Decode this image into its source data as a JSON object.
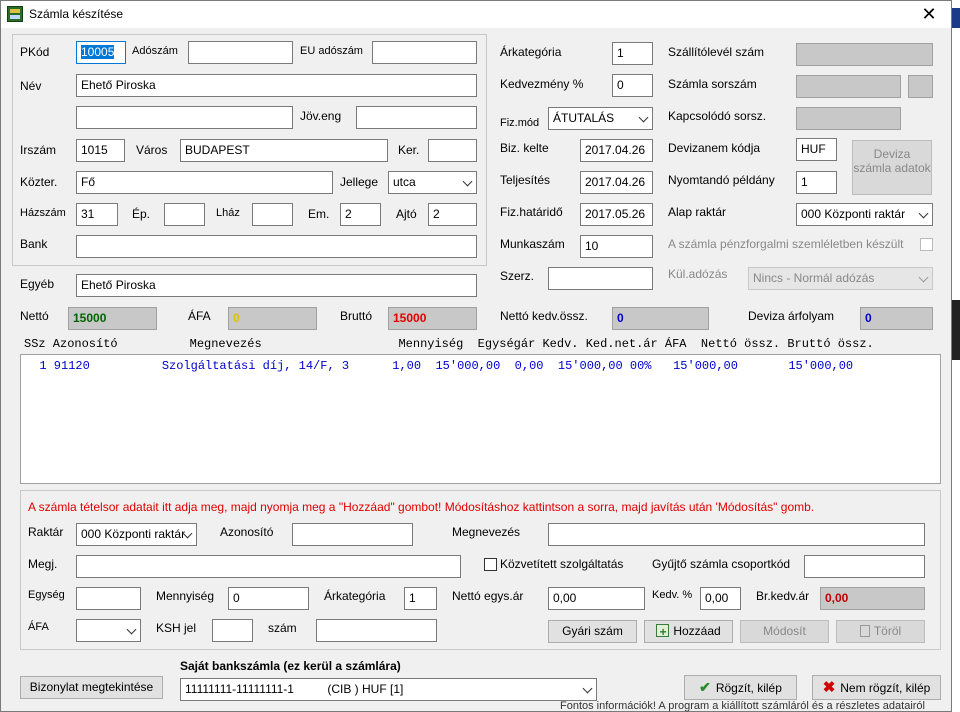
{
  "window": {
    "title": "Számla készítése",
    "close": "✕"
  },
  "customer": {
    "pkod_label": "PKód",
    "pkod_value": "10005",
    "adoszam_label": "Adószám",
    "adoszam_value": "",
    "eu_label": "EU adószám",
    "eu_value": "",
    "nev_label": "Név",
    "nev_value": "Ehető Piroska",
    "nev2_value": "",
    "joveng_label": "Jöv.eng",
    "joveng_value": "",
    "irszam_label": "Irszám",
    "irszam_value": "1015",
    "varos_label": "Város",
    "varos_value": "BUDAPEST",
    "ker_label": "Ker.",
    "ker_value": "",
    "kozter_label": "Közter.",
    "kozter_value": "Fő",
    "jellege_label": "Jellege",
    "jellege_value": "utca",
    "hazszam_label": "Házszám",
    "hazszam_value": "31",
    "ep_label": "Ép.",
    "ep_value": "",
    "lhaz_label": "Lház",
    "lhaz_value": "",
    "em_label": "Em.",
    "em_value": "2",
    "ajto_label": "Ajtó",
    "ajto_value": "2",
    "bank_label": "Bank",
    "bank_value": "",
    "egyeb_label": "Egyéb",
    "egyeb_value": "Ehető Piroska"
  },
  "totals": {
    "netto_label": "Nettó",
    "netto_value": "15000",
    "afa_label": "ÁFA",
    "afa_value": "0",
    "brutto_label": "Bruttó",
    "brutto_value": "15000",
    "netto_kedv_label": "Nettó kedv.össz.",
    "netto_kedv_value": "0",
    "deviza_arf_label": "Deviza árfolyam",
    "deviza_arf_value": "0"
  },
  "invoice": {
    "arkat_label": "Árkategória",
    "arkat_value": "1",
    "kedv_label": "Kedvezmény %",
    "kedv_value": "0",
    "fizmod_label": "Fiz.mód",
    "fizmod_value": "ÁTUTALÁS",
    "bizkelte_label": "Biz. kelte",
    "bizkelte_value": "2017.04.26",
    "telj_label": "Teljesítés",
    "telj_value": "2017.04.26",
    "hatarido_label": "Fiz.határidő",
    "hatarido_value": "2017.05.26",
    "munkaszam_label": "Munkaszám",
    "munkaszam_value": "10",
    "szerz_label": "Szerz.",
    "szerz_value": ""
  },
  "right": {
    "szallito_label": "Szállítólevél szám",
    "sorszam_label": "Számla sorszám",
    "kapcs_label": "Kapcsolódó sorsz.",
    "devizanem_label": "Devizanem kódja",
    "devizanem_value": "HUF",
    "nyomt_label": "Nyomtandó példány",
    "nyomt_value": "1",
    "deviza_btn": "Deviza számla adatok",
    "raktar_label": "Alap raktár",
    "raktar_value": "000 Központi raktár",
    "penzforg_label": "A számla pénzforgalmi szemléletben készült",
    "kuladozas_label": "Kül.adózás",
    "kuladozas_value": "Nincs - Normál adózás"
  },
  "grid": {
    "header": "SSz Azonosító          Megnevezés                   Mennyiség  Egységár Kedv. Ked.net.ár ÁFA  Nettó össz. Bruttó össz.",
    "rows": [
      "  1 91120          Szolgáltatási díj, 14/F, 3      1,00  15'000,00  0,00  15'000,00 00%   15'000,00       15'000,00"
    ]
  },
  "item": {
    "hint": "A számla tételsor adatait itt adja meg, majd nyomja meg a \"Hozzáad\" gombot! Módosításhoz kattintson a sorra, majd javítás után 'Módosítás\" gomb.",
    "raktar_label": "Raktár",
    "raktar_value": "000 Központi raktár",
    "azon_label": "Azonosító",
    "azon_value": "",
    "megnev_label": "Megnevezés",
    "megnev_value": "",
    "megj_label": "Megj.",
    "megj_value": "",
    "kozvetitett_label": "Közvetített szolgáltatás",
    "gyujto_label": "Gyűjtő számla csoportkód",
    "gyujto_value": "",
    "egyseg_label": "Egység",
    "egyseg_value": "",
    "menny_label": "Mennyiség",
    "menny_value": "0",
    "arkat_label": "Árkategória",
    "arkat_value": "1",
    "nettoegys_label": "Nettó egys.ár",
    "nettoegys_value": "0,00",
    "kedv_label": "Kedv. %",
    "kedv_value": "0,00",
    "brkedv_label": "Br.kedv.ár",
    "brkedv_value": "0,00",
    "afa_label": "ÁFA",
    "afa_value": "",
    "ksh_label": "KSH jel",
    "ksh_value": "",
    "szam_label": "szám",
    "szam_value": "",
    "gyari_btn": "Gyári szám",
    "hozzaad_btn": "Hozzáad",
    "modosit_btn": "Módosít",
    "torol_btn": "Töröl"
  },
  "footer": {
    "bizonylat_btn": "Bizonylat megtekintése",
    "bank_label": "Saját bankszámla (ez kerül a számlára)",
    "bank_value": "11111111-11111111-1          (CIB ) HUF [1]",
    "rogzit_btn": "Rögzít, kilép",
    "nemrogzit_btn": "Nem rögzít, kilép"
  },
  "background": {
    "text": "Fontos információk! A program a kiállított számláról és a részletes adatairól"
  },
  "colors": {
    "focus": "#0078d7",
    "netto": "#006400",
    "afa": "#e0c000",
    "brutto": "#e00000",
    "blue": "#0000cc",
    "hint": "#e00000"
  }
}
